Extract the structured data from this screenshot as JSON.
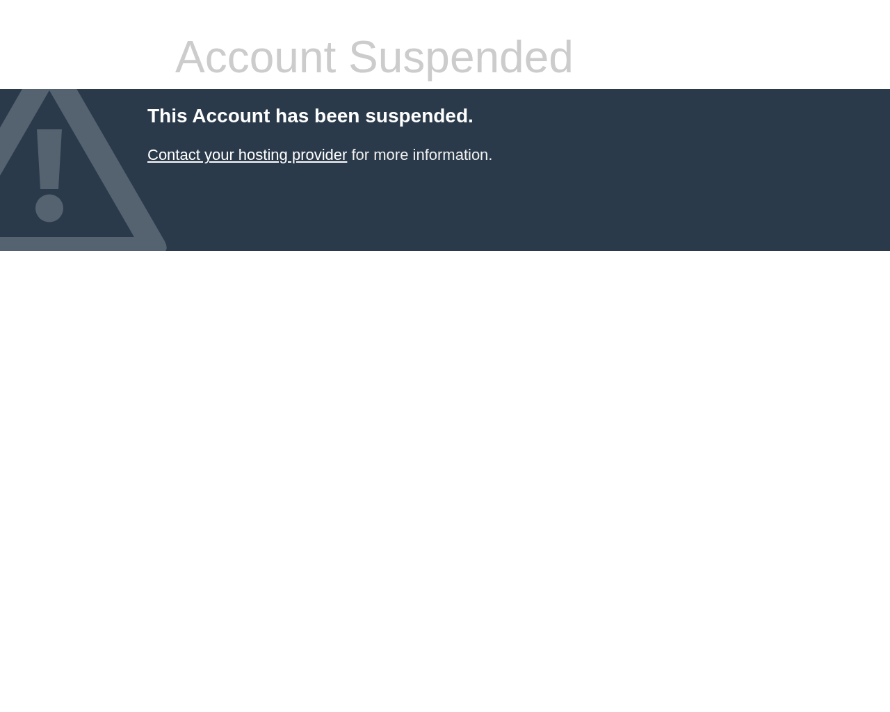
{
  "header": {
    "title": "Account Suspended"
  },
  "notice": {
    "heading": "This Account has been suspended.",
    "message": {
      "link": "Contact your hosting provider",
      "text": "for more information."
    }
  }
}
